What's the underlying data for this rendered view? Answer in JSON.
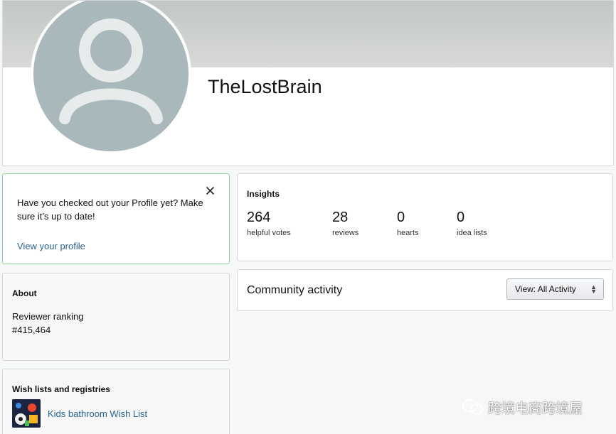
{
  "profile": {
    "username": "TheLostBrain"
  },
  "prompt": {
    "message": "Have you checked out your Profile yet? Make sure it’s up to date!",
    "link_label": "View your profile",
    "close_icon": "close-icon"
  },
  "about": {
    "heading": "About",
    "ranking_label": "Reviewer ranking",
    "ranking_value": "#415,464"
  },
  "wishlists": {
    "heading": "Wish lists and registries",
    "items": [
      {
        "label": "Kids bathroom Wish List"
      }
    ]
  },
  "insights": {
    "heading": "Insights",
    "stats": [
      {
        "value": "264",
        "label": "helpful votes"
      },
      {
        "value": "28",
        "label": "reviews"
      },
      {
        "value": "0",
        "label": "hearts"
      },
      {
        "value": "0",
        "label": "idea lists"
      }
    ]
  },
  "community": {
    "title": "Community activity",
    "view_select": "View:  All Activity"
  },
  "watermark": {
    "text": "跨境电商跨境屋"
  },
  "colors": {
    "link": "#2a6496",
    "avatar_bg": "#a9b8ba",
    "prompt_border": "#8fd19a"
  }
}
